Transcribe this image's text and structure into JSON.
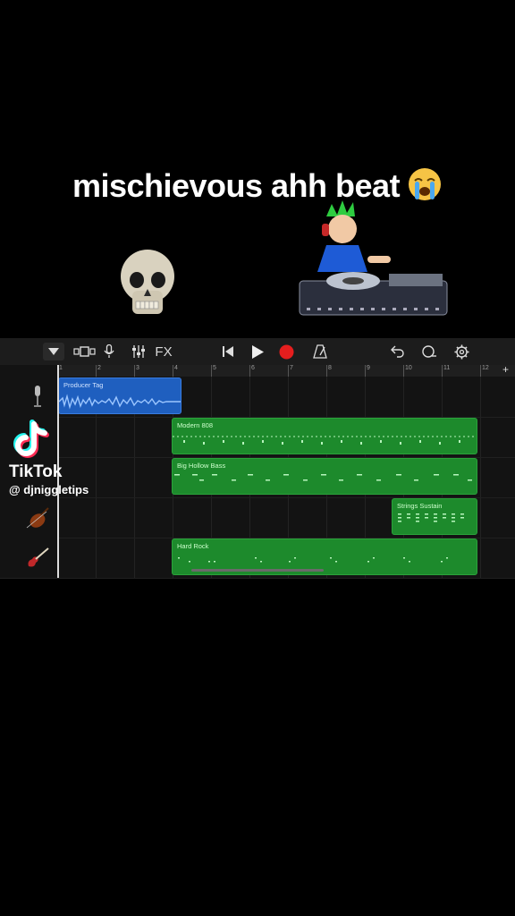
{
  "caption": {
    "text": "mischievous ahh beat"
  },
  "toolbar": {
    "fx_label": "FX"
  },
  "ruler": {
    "marks": [
      "1",
      "2",
      "3",
      "4",
      "5",
      "6",
      "7",
      "8",
      "9",
      "10",
      "11",
      "12"
    ],
    "add_symbol": "+"
  },
  "tracks": [
    {
      "instrument_icon": "microphone-icon",
      "region": {
        "name": "Producer Tag",
        "color": "#1f5fbf"
      }
    },
    {
      "instrument_icon": "drum-machine-icon",
      "region": {
        "name": "Modern 808",
        "color": "#1d8a2c"
      }
    },
    {
      "instrument_icon": "bass-icon",
      "region": {
        "name": "Big Hollow Bass",
        "color": "#1d8a2c"
      }
    },
    {
      "instrument_icon": "violin-icon",
      "region": {
        "name": "Strings Sustain",
        "color": "#1d8a2c"
      }
    },
    {
      "instrument_icon": "electric-guitar-icon",
      "region": {
        "name": "Hard Rock",
        "color": "#1d8a2c"
      }
    }
  ],
  "overlay": {
    "platform": "TikTok",
    "username": "@ djniggletips"
  },
  "colors": {
    "record": "#e51e1e",
    "region_green": "#1d8a2c",
    "region_blue": "#1f5fbf"
  }
}
